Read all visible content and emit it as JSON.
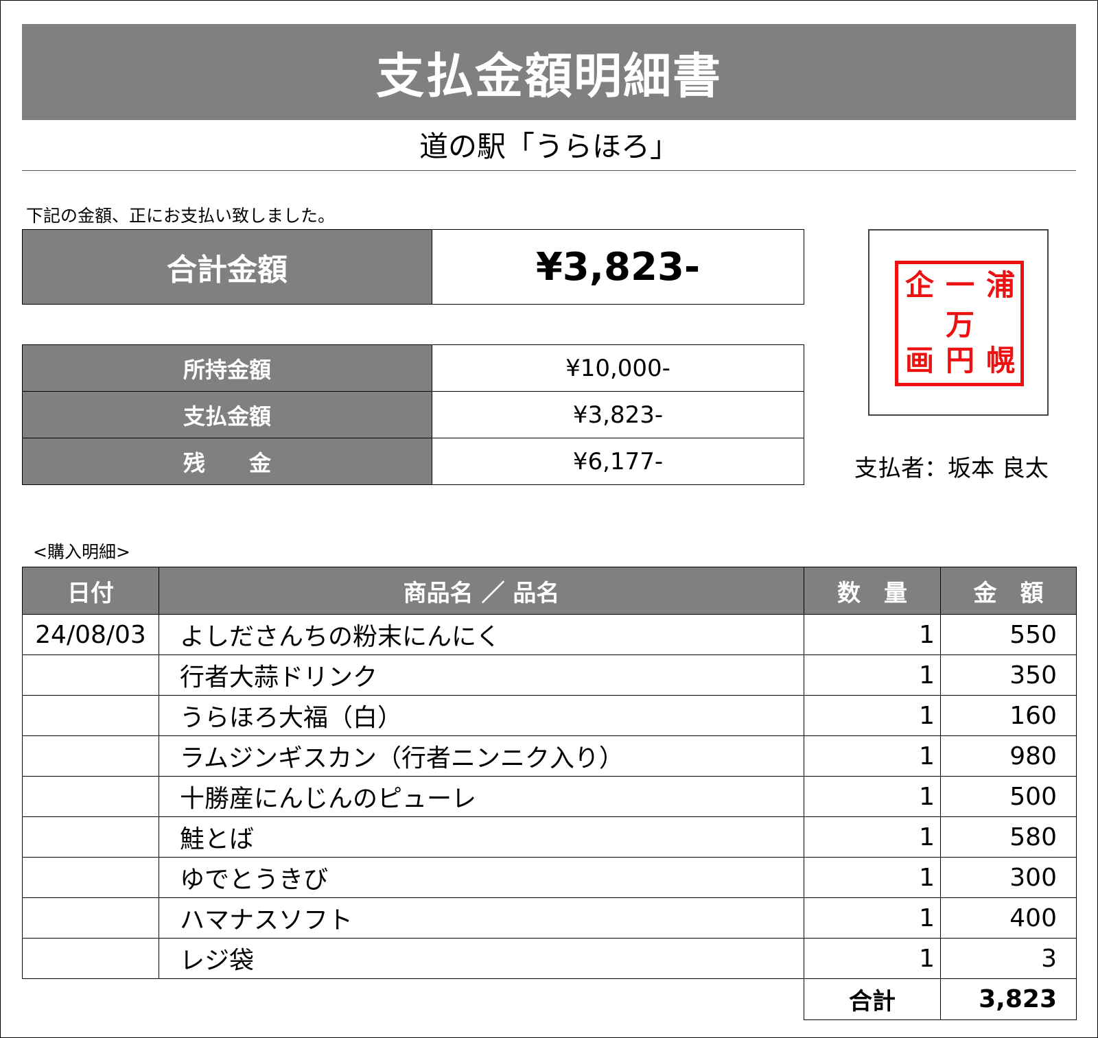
{
  "document": {
    "title": "支払金額明細書",
    "store": "道の駅「うらほろ」",
    "notice": "下記の金額、正にお支払い致しました。"
  },
  "total": {
    "label": "合計金額",
    "value": "¥3,823-"
  },
  "summary": [
    {
      "label": "所持金額",
      "value": "¥10,000-"
    },
    {
      "label": "支払金額",
      "value": "¥3,823-"
    },
    {
      "label": "残　　金",
      "value": "¥6,177-"
    }
  ],
  "stamp": {
    "text": "浦幌一万円企画",
    "color": "#ee1111"
  },
  "payer": "支払者：坂本 良太",
  "detail": {
    "caption": "<購入明細>",
    "headers": [
      "日付",
      "商品名 ／ 品名",
      "数　量",
      "金　額"
    ],
    "rows": [
      {
        "date": "24/08/03",
        "name": "よしださんちの粉末にんにく",
        "qty": "1",
        "amount": "550"
      },
      {
        "date": "",
        "name": "行者大蒜ドリンク",
        "qty": "1",
        "amount": "350"
      },
      {
        "date": "",
        "name": "うらほろ大福（白）",
        "qty": "1",
        "amount": "160"
      },
      {
        "date": "",
        "name": "ラムジンギスカン（行者ニンニク入り）",
        "qty": "1",
        "amount": "980"
      },
      {
        "date": "",
        "name": "十勝産にんじんのピューレ",
        "qty": "1",
        "amount": "500"
      },
      {
        "date": "",
        "name": "鮭とば",
        "qty": "1",
        "amount": "580"
      },
      {
        "date": "",
        "name": "ゆでとうきび",
        "qty": "1",
        "amount": "300"
      },
      {
        "date": "",
        "name": "ハマナスソフト",
        "qty": "1",
        "amount": "400"
      },
      {
        "date": "",
        "name": "レジ袋",
        "qty": "1",
        "amount": "3"
      }
    ],
    "total_label": "合計",
    "total_value": "3,823"
  },
  "colors": {
    "header_gray": "#808080",
    "stamp_red": "#ee1111"
  }
}
